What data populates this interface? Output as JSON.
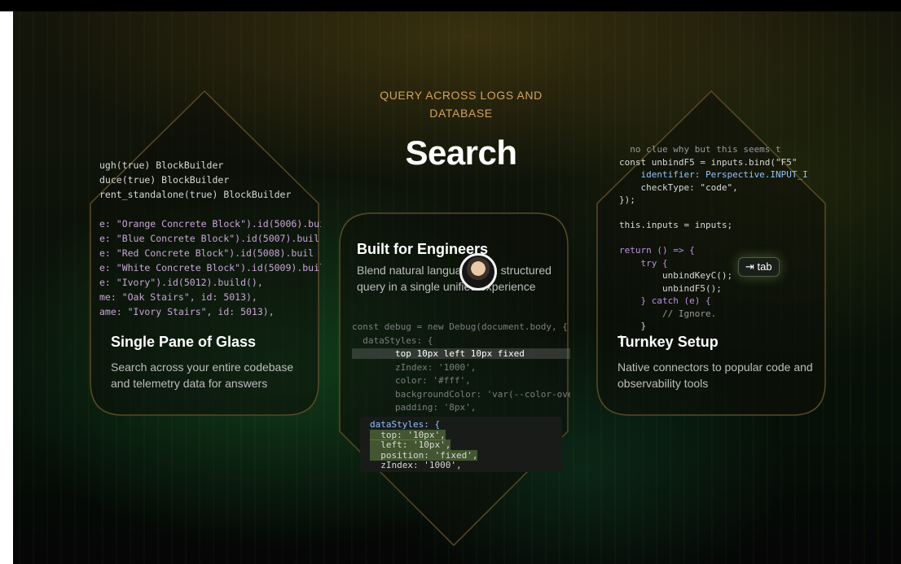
{
  "heading": {
    "eyebrow": "QUERY ACROSS LOGS AND DATABASE",
    "title": "Search"
  },
  "cards": {
    "left": {
      "title": "Single Pane of Glass",
      "description": "Search across your entire codebase and telemetry data for answers",
      "code": [
        "ugh(true) BlockBuilder",
        "duce(true) BlockBuilder",
        "rent_standalone(true) BlockBuilder",
        "",
        "e: \"Orange Concrete Block\").id(5006).buil",
        "e: \"Blue Concrete Block\").id(5007).buil",
        "e: \"Red Concrete Block\").id(5008).buil",
        "e: \"White Concrete Block\").id(5009).buil",
        "e: \"Ivory\").id(5012).build(),",
        "me: \"Oak Stairs\", id: 5013),",
        "ame: \"Ivory Stairs\", id: 5013),"
      ]
    },
    "center": {
      "title": "Built for Engineers",
      "description": "Blend natural language with structured query in a single unified experience",
      "code_top": [
        "const debug = new Debug(document.body, {",
        "  dataStyles: {",
        "        top 10px left 10px fixed",
        "        zIndex: '1000',",
        "        color: '#fff',",
        "        backgroundColor: 'var(--color-ove",
        "        padding: '8px',"
      ],
      "code_bottom": [
        "dataStyles: {",
        "  top: '10px',",
        "  left: '10px',",
        "  position: 'fixed',",
        "  zIndex: '1000',"
      ]
    },
    "right": {
      "title": "Turnkey Setup",
      "description": "Native connectors to popular code and observability tools",
      "tab_hint": "⇥ tab",
      "code": [
        "  no clue why but this seems t",
        "const unbindF5 = inputs.bind(\"F5\"",
        "    identifier: Perspective.INPUT_I",
        "    checkType: \"code\",",
        "});",
        "",
        "this.inputs = inputs;",
        "",
        "return () => {",
        "    try {",
        "        unbindKeyC();",
        "        unbindF5();",
        "    } catch (e) {",
        "        // Ignore.",
        "    }",
        "};"
      ]
    }
  },
  "colors": {
    "accent": "#d3a25c",
    "border": "#5a4a26"
  }
}
